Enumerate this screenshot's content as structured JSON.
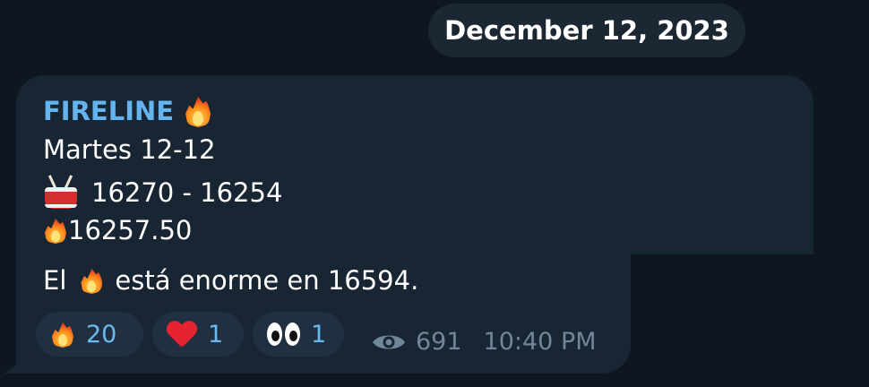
{
  "date_label": "December 12, 2023",
  "message": {
    "sender": "FIRELINE",
    "sender_icon": "fire-icon",
    "lines": [
      "Martes 12-12",
      "16270 - 16254",
      "16257.50",
      "El",
      "está enorme en 16594."
    ],
    "line_icons": {
      "line2": "drum-icon",
      "line3": "fire-icon",
      "line4": "fire-icon"
    },
    "views": "691",
    "time": "10:40 PM"
  },
  "reactions": [
    {
      "icon": "fire-icon",
      "count": "20"
    },
    {
      "icon": "heart-icon",
      "count": "1"
    },
    {
      "icon": "eyes-icon",
      "count": "1"
    }
  ],
  "colors": {
    "background": "#0e1621",
    "bubble": "#182533",
    "sender": "#64b5ef",
    "reaction_bg": "#213041",
    "reaction_count": "#6cb8f0",
    "meta": "#6f8799"
  }
}
